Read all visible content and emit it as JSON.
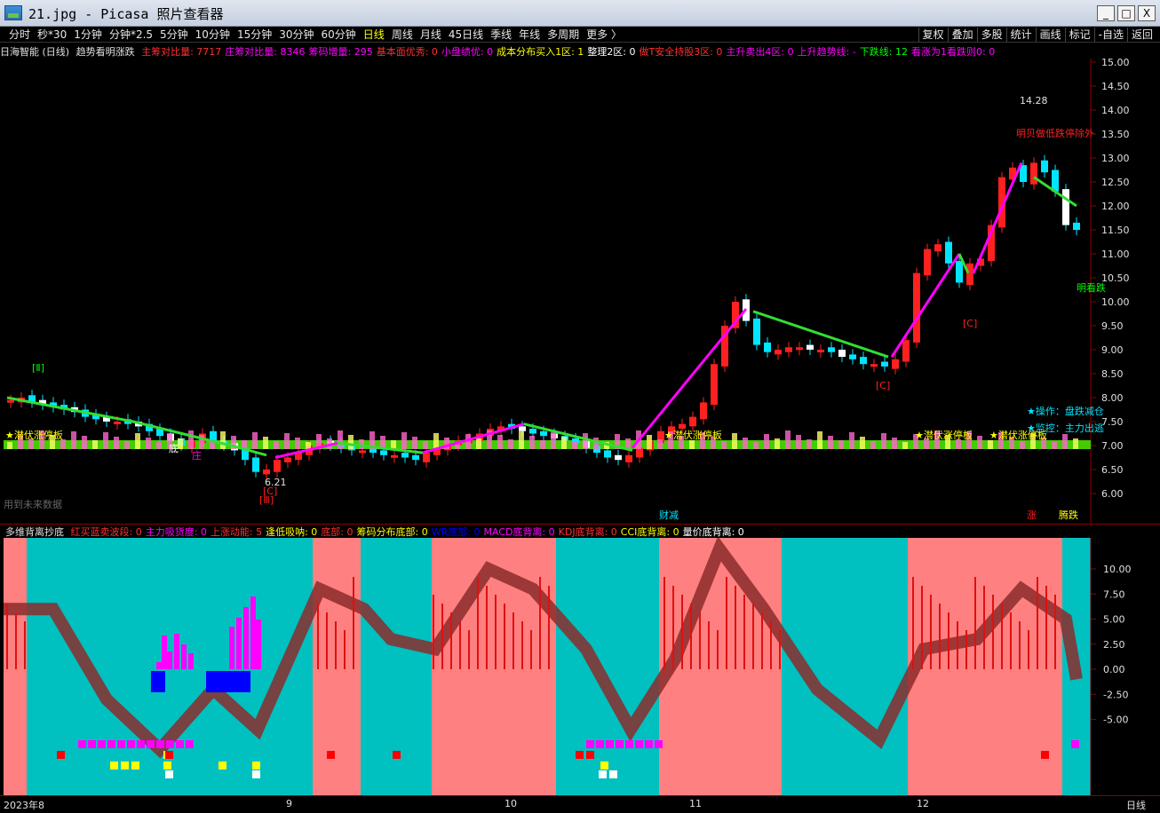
{
  "window": {
    "title": "21.jpg - Picasa 照片查看器",
    "min": "_",
    "max": "□",
    "close": "X"
  },
  "toolbar": {
    "periods": [
      "分时",
      "秒*30",
      "1分钟",
      "分钟*2.5",
      "5分钟",
      "10分钟",
      "15分钟",
      "30分钟",
      "60分钟",
      "日线",
      "周线",
      "月线",
      "45日线",
      "季线",
      "年线",
      "多周期",
      "更多 〉"
    ],
    "active_period": "日线",
    "right": [
      "复权",
      "叠加",
      "多股",
      "统计",
      "画线",
      "标记",
      "-自选",
      "返回"
    ]
  },
  "info": {
    "stock": "日海智能 (日线)",
    "indicator": "趋势看明涨跌",
    "items": [
      {
        "text": "主筹对比量: 7717",
        "color": "#ff3030"
      },
      {
        "text": "庄筹对比量: 8346",
        "color": "#ff00ff"
      },
      {
        "text": "筹码增量: 295",
        "color": "#ff00ff"
      },
      {
        "text": "基本面优秀: 0",
        "color": "#ff3030"
      },
      {
        "text": "小盘绩优: 0",
        "color": "#ff00ff"
      },
      {
        "text": "成本分布买入1区: 1",
        "color": "#ffff00"
      },
      {
        "text": "整理2区: 0",
        "color": "#ffffff"
      },
      {
        "text": "做T安全持股3区: 0",
        "color": "#ff3030"
      },
      {
        "text": "主升卖出4区: 0",
        "color": "#ff00ff"
      },
      {
        "text": "上升趋势线: -",
        "color": "#ff00ff"
      },
      {
        "text": "下跌线: 12",
        "color": "#00ff00"
      },
      {
        "text": "看涨为1看跌则0: 0",
        "color": "#ff00ff"
      }
    ]
  },
  "price_axis": [
    "15.00",
    "14.50",
    "14.00",
    "13.50",
    "13.00",
    "12.50",
    "12.00",
    "11.50",
    "11.00",
    "10.50",
    "10.00",
    "9.50",
    "9.00",
    "8.50",
    "8.00",
    "7.50",
    "7.00",
    "6.50",
    "6.00"
  ],
  "annotations": {
    "high": "14.28",
    "low": "6.21",
    "left_tag": "★潜伏涨停板",
    "mid_tag": "★潜伏涨停板",
    "right_tag1": "★潜伏涨停板",
    "right_tag2": "★潜伏涨停板",
    "op1": "★操作：盘跌减仓",
    "op2": "★监控：主力出逃",
    "future": "用到未来数据",
    "note_top": "明贝做低跌停除外",
    "note_right": "明看跌",
    "caiwu": "财减",
    "zhang": "涨",
    "die": "跌",
    "die2": "腾跌",
    "tag_II": "[Ⅱ]",
    "tag_III": "[Ⅲ]",
    "tag_C1": "[C]",
    "tag_C2": "[C]",
    "tag_C3": "[C]",
    "di": "底",
    "zhuang": "庄"
  },
  "lower": {
    "title": "多维背离抄底",
    "items": [
      {
        "text": "红买蓝卖波段: 0",
        "color": "#ff3030"
      },
      {
        "text": "主力吸货度: 0",
        "color": "#ff00ff"
      },
      {
        "text": "上涨动能: 5",
        "color": "#ff3030"
      },
      {
        "text": "逢低吸呐: 0",
        "color": "#ffff00"
      },
      {
        "text": "底部: 0",
        "color": "#ff3030"
      },
      {
        "text": "筹码分布底部: 0",
        "color": "#ffff00"
      },
      {
        "text": "WR底部: 0",
        "color": "#0000ff"
      },
      {
        "text": "MACD底背离: 0",
        "color": "#ff00ff"
      },
      {
        "text": "KDJ底背离: 0",
        "color": "#ff3030"
      },
      {
        "text": "CCI底背离: 0",
        "color": "#ffff00"
      },
      {
        "text": "量价底背离: 0",
        "color": "#ffffff"
      }
    ],
    "axis": [
      "10.00",
      "7.50",
      "5.00",
      "2.50",
      "0.00",
      "-2.50",
      "-5.00"
    ]
  },
  "dates": {
    "d1": "2023年8",
    "d2": "9",
    "d3": "10",
    "d4": "11",
    "d5": "12",
    "period": "日线"
  },
  "colors": {
    "up": "#ff2020",
    "down": "#00e5ff",
    "pink": "#ff8080",
    "cyan": "#00c0c0",
    "green": "#00ff00",
    "magenta": "#ff00ff"
  }
}
